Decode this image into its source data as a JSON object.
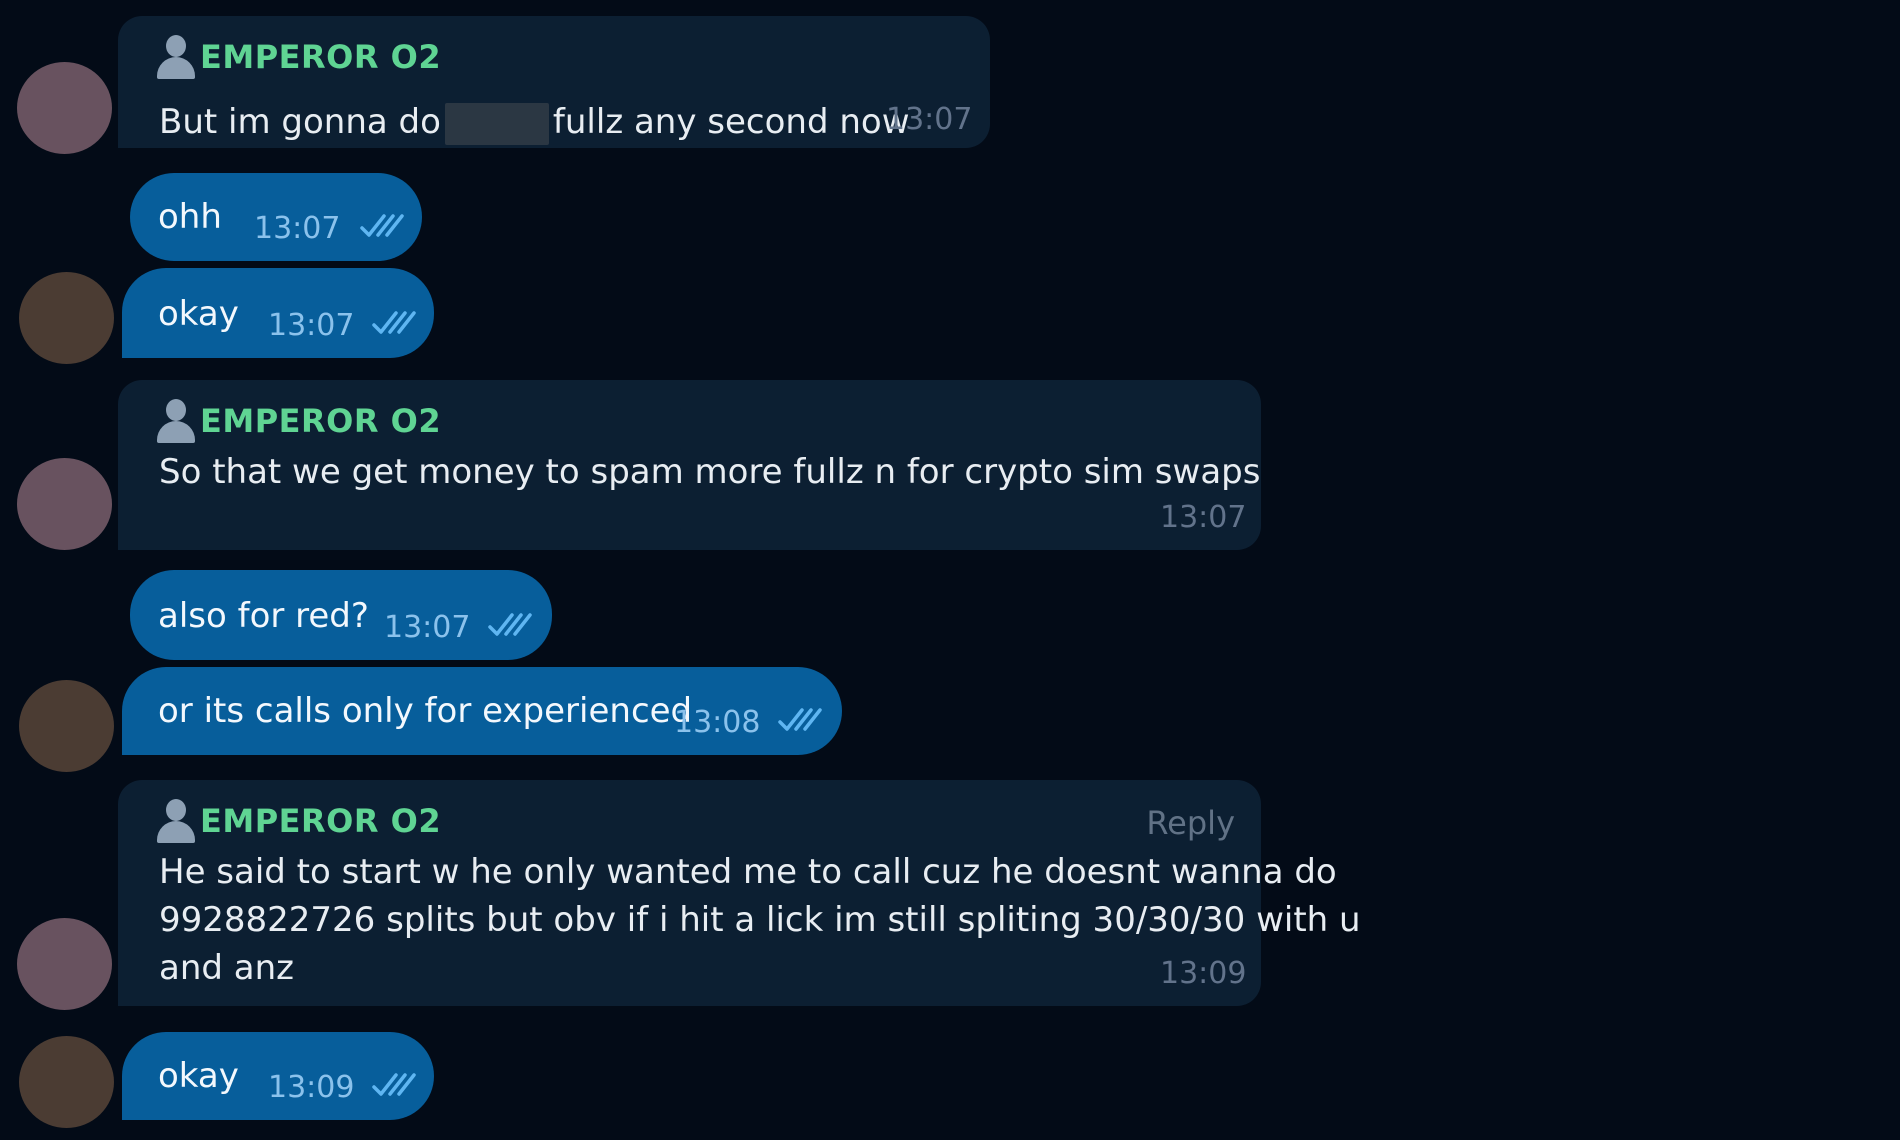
{
  "messages": [
    {
      "direction": "incoming",
      "sender": "EMPEROR O2",
      "text_before": "But im gonna do",
      "text_after": "fullz any second now",
      "time": "13:07"
    },
    {
      "direction": "outgoing",
      "text": "ohh",
      "time": "13:07",
      "status": "read"
    },
    {
      "direction": "outgoing",
      "text": "okay",
      "time": "13:07",
      "status": "read"
    },
    {
      "direction": "incoming",
      "sender": "EMPEROR O2",
      "text": "So that we get money to spam more fullz n for crypto sim swaps",
      "time": "13:07"
    },
    {
      "direction": "outgoing",
      "text": "also for red?",
      "time": "13:07",
      "status": "read"
    },
    {
      "direction": "outgoing",
      "text": "or its calls only for experienced",
      "time": "13:08",
      "status": "read"
    },
    {
      "direction": "incoming",
      "sender": "EMPEROR O2",
      "reply_label": "Reply",
      "lines": [
        "He said to start w he only wanted me to call cuz he doesnt wanna do",
        "9928822726 splits but obv if i hit a lick im still spliting 30/30/30 with u",
        "and anz"
      ],
      "time": "13:09"
    },
    {
      "direction": "outgoing",
      "text": "okay",
      "time": "13:09",
      "status": "read"
    }
  ],
  "colors": {
    "background": "#030b17",
    "incoming_bubble": "#0c1f32",
    "outgoing_bubble": "#075e9b",
    "sender_name": "#5fd493",
    "check_marks": "#5fb6f2"
  },
  "icons": {
    "sender": "person-icon",
    "read_receipt": "double-check-icon"
  }
}
